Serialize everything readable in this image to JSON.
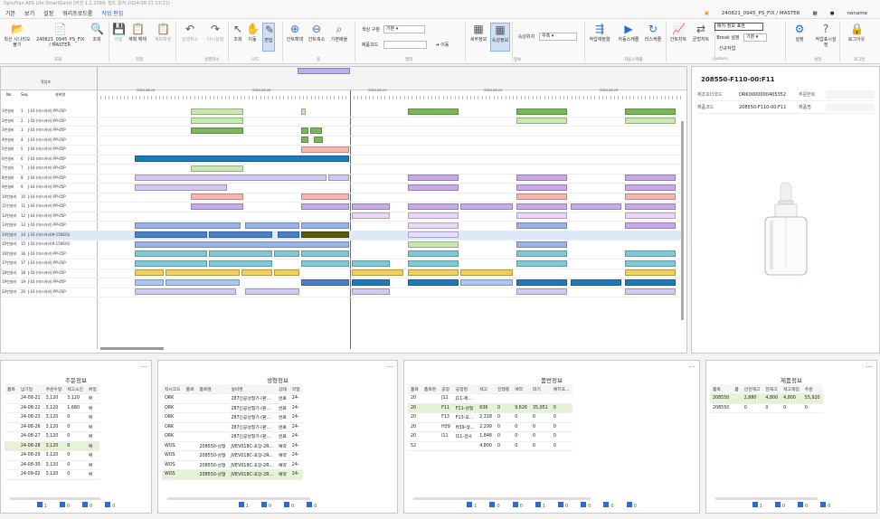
{
  "titlebar": {
    "text": "SyncPlan APS Lite SmartGantt (버전 1.2.2099, 빌드 일자 2024-08-21 13:11)"
  },
  "menu": {
    "items": [
      "기본",
      "보기",
      "설정",
      "워리프로드룸",
      "작업 편집"
    ],
    "active": "작업 편집"
  },
  "header_right": {
    "scenario": "240821_0945_PS_FIX / MASTER",
    "user": "noname"
  },
  "ribbon": {
    "buttons": [
      {
        "id": "open",
        "label": "최신 시나리오 불기",
        "icon": "📂"
      },
      {
        "id": "scn",
        "label": "240821_0945_PS_FIX / MASTER",
        "icon": "📄"
      },
      {
        "id": "query",
        "label": "조회",
        "icon": "🔍"
      },
      {
        "id": "save",
        "label": "저장",
        "icon": "💾"
      },
      {
        "id": "planedit",
        "label": "계획 해제",
        "icon": "📋"
      },
      {
        "id": "plansave",
        "label": "계획확정",
        "icon": "📋"
      },
      {
        "id": "undo",
        "label": "실행취소",
        "icon": "↶"
      },
      {
        "id": "redo",
        "label": "다시실행",
        "icon": "↷"
      },
      {
        "id": "select",
        "label": "조회",
        "icon": "↖"
      },
      {
        "id": "move",
        "label": "이동",
        "icon": "✋"
      },
      {
        "id": "edit",
        "label": "편집",
        "icon": "✎"
      },
      {
        "id": "zoomin",
        "label": "간트확대",
        "icon": "⊕"
      },
      {
        "id": "zoomout",
        "label": "간트축소",
        "icon": "⊖"
      },
      {
        "id": "zoomdef",
        "label": "기본배율",
        "icon": "⌕"
      },
      {
        "id": "worksel",
        "label": "세부정보",
        "icon": "▦"
      },
      {
        "id": "attrsel",
        "label": "속성정보",
        "icon": "▦"
      },
      {
        "id": "reseq",
        "label": "작업재정렬",
        "icon": "⇶"
      },
      {
        "id": "autosched",
        "label": "자동스케줄",
        "icon": "▶"
      },
      {
        "id": "resched",
        "label": "리스케줄",
        "icon": "↻"
      },
      {
        "id": "gantt",
        "label": "간트차트",
        "icon": "📈"
      },
      {
        "id": "balance",
        "label": "균형차트",
        "icon": "⇄"
      },
      {
        "id": "settings",
        "label": "설정",
        "icon": "⚙"
      },
      {
        "id": "help",
        "label": "작업표시설정",
        "icon": "?"
      },
      {
        "id": "logout",
        "label": "로그아웃",
        "icon": "🔒"
      }
    ],
    "groups": [
      "조회",
      "작업",
      "실행취소",
      "모드",
      "줌",
      "필터",
      "정보",
      "자동스케줄",
      "custom",
      "설정",
      "로그인"
    ],
    "search": {
      "label1": "색상 구분",
      "value1": "기본",
      "label2": "제품코드",
      "value2": "",
      "go": "이동"
    },
    "attr": {
      "label": "속성위치",
      "value": "우측"
    },
    "custom": {
      "btn": "배치 정보 표현",
      "break_label": "Break 설정",
      "break_value": "기본",
      "newjob": "신규작업"
    }
  },
  "gantt": {
    "header_left": "작업조",
    "cols": [
      "No",
      "Seq",
      "설비명"
    ],
    "dates": [
      "2024-08-19",
      "2024-08-20",
      "2024-08-21",
      "2024-08-22",
      "2024-08-23",
      "2024-08-24"
    ],
    "rows": [
      "J-16 (마스카라) PP-05P",
      "J-16 (마스카라) PP-05P",
      "J-16 (마스카라) PP-05P",
      "J-16 (마스카라) PP-05P",
      "J-16 (마스카라) PP-05P",
      "J-16 (마스카라) PP-05P",
      "J-16 (마스카라) PP-05P",
      "J-16 (마스카라) PP-05P",
      "J-16 (마스카라) PP-05P",
      "J-16 (마스카라) PP-05P",
      "J-16 (마스카라) PP-05P",
      "J-16 (마스카라) PP-05P",
      "J-16 (마스카라) PP-05P",
      "J-16 (마스카라)9-1506(S)",
      "J-16 (마스카라)9-1506(S)",
      "J-16 (마스카라) PP-05P",
      "J-16 (마스카라) PP-05P",
      "J-16 (마스카라) PP-05P",
      "J-16 (마스카라) PP-05P",
      "J-16 (마스카라) PP-05P"
    ],
    "rowheads": [
      "1번설비",
      "2번설비",
      "3번설비",
      "4번설비",
      "5번설비",
      "6번설비",
      "7번설비",
      "8번설비",
      "9번설비",
      "10번설비",
      "11번설비",
      "12번설비",
      "13번설비",
      "14번설비",
      "15번설비",
      "16번설비",
      "17번설비",
      "18번설비",
      "19번설비",
      "20번설비"
    ]
  },
  "detail": {
    "title": "208550-F110-00:F11",
    "fields": [
      {
        "k": "제조오더코드",
        "v": "ORK0000000405352",
        "k2": "주문번호",
        "v2": ""
      },
      {
        "k": "제품코드",
        "v": "208550-F110-00:F11",
        "k2": "제품명",
        "v2": ""
      }
    ]
  },
  "panels": {
    "order": {
      "title": "주문정보",
      "cols": [
        "품목",
        "납기일",
        "주문수량",
        "재고소진",
        "확정"
      ],
      "rows": [
        [
          "",
          "24-08-21",
          "3,120",
          "3,120",
          "확"
        ],
        [
          "",
          "24-08-22",
          "3,120",
          "1,680",
          "확"
        ],
        [
          "",
          "24-08-23",
          "3,120",
          "0",
          "확"
        ],
        [
          "",
          "24-08-26",
          "3,120",
          "0",
          "확"
        ],
        [
          "",
          "24-08-27",
          "3,120",
          "0",
          "확"
        ],
        [
          "",
          "24-08-28",
          "3,120",
          "0",
          "확"
        ],
        [
          "",
          "24-08-29",
          "3,120",
          "0",
          "확"
        ],
        [
          "",
          "24-08-30",
          "3,120",
          "0",
          "확"
        ],
        [
          "",
          "24-09-02",
          "3,120",
          "0",
          "확"
        ]
      ],
      "foot": [
        "1",
        "0",
        "0",
        "0"
      ]
    },
    "production": {
      "title": "생형정보",
      "cols": [
        "지시코드",
        "품목",
        "품목명",
        "설비명",
        "상태",
        "작업"
      ],
      "rows": [
        [
          "ORK",
          "",
          "",
          "287인공성형기-(판...",
          "완료",
          "24-"
        ],
        [
          "ORK",
          "",
          "",
          "287인공성형기-(판...",
          "완료",
          "24-"
        ],
        [
          "ORK",
          "",
          "",
          "287인공성형기-(판...",
          "완료",
          "24-"
        ],
        [
          "ORK",
          "",
          "",
          "287인공성형기-(판...",
          "완료",
          "24-"
        ],
        [
          "ORK",
          "",
          "",
          "287인공성형기-(판...",
          "완료",
          "24-"
        ],
        [
          "WOS",
          "",
          "208550-성형",
          "JVEV018C-포장-2R...",
          "예약",
          "24-"
        ],
        [
          "WOS",
          "",
          "208550-성형",
          "JVEV018C-포장-2R...",
          "예약",
          "24-"
        ],
        [
          "WOS",
          "",
          "208550-성형",
          "JVEV018C-포장-2R...",
          "예약",
          "24-"
        ],
        [
          "WOS",
          "",
          "208550-성형",
          "JVEV018C-포장-2R...",
          "예약",
          "24-"
        ]
      ],
      "foot": [
        "1",
        "0",
        "0",
        "0"
      ]
    },
    "material": {
      "title": "품번정보",
      "cols": [
        "품목",
        "품목명",
        "공정",
        "공정명",
        "재고",
        "진행중",
        "예약",
        "대기",
        "예치포..."
      ],
      "rows": [
        [
          "20",
          "",
          "J11",
          "J11-제...",
          "",
          "",
          "",
          "",
          ""
        ],
        [
          "20",
          "",
          "F11",
          "F11-성형",
          "636",
          "0",
          "9,626",
          "35,051",
          "0"
        ],
        [
          "20",
          "",
          "F13",
          "F13-포...",
          "2,318",
          "0",
          "0",
          "0",
          "0"
        ],
        [
          "20",
          "",
          "H39",
          "H39-생...",
          "2,299",
          "0",
          "0",
          "0",
          "0"
        ],
        [
          "20",
          "",
          "I11",
          "I11-검사",
          "1,848",
          "0",
          "0",
          "0",
          "0"
        ],
        [
          "52",
          "",
          "",
          "",
          "4,800",
          "0",
          "0",
          "0",
          "0"
        ]
      ],
      "foot": [
        "1",
        "0",
        "0",
        "1",
        "0",
        "0",
        "0",
        "0"
      ]
    },
    "product": {
      "title": "제품정보",
      "cols": [
        "품목",
        "품",
        "안전재고",
        "현재고",
        "재고재입",
        "주문"
      ],
      "rows": [
        [
          "208550",
          "",
          "2,880",
          "4,800",
          "4,800",
          "55,920"
        ],
        [
          "208550",
          "",
          "0",
          "0",
          "0",
          "0"
        ]
      ],
      "foot": [
        "1",
        "0",
        "0",
        "0"
      ]
    }
  },
  "colors": {
    "accent": "#2a6bd6",
    "green": "#7ab85a",
    "purple": "#c9a9e8",
    "blue": "#4a80c8",
    "teal": "#7fcad6",
    "yellow": "#f0cf5a"
  }
}
